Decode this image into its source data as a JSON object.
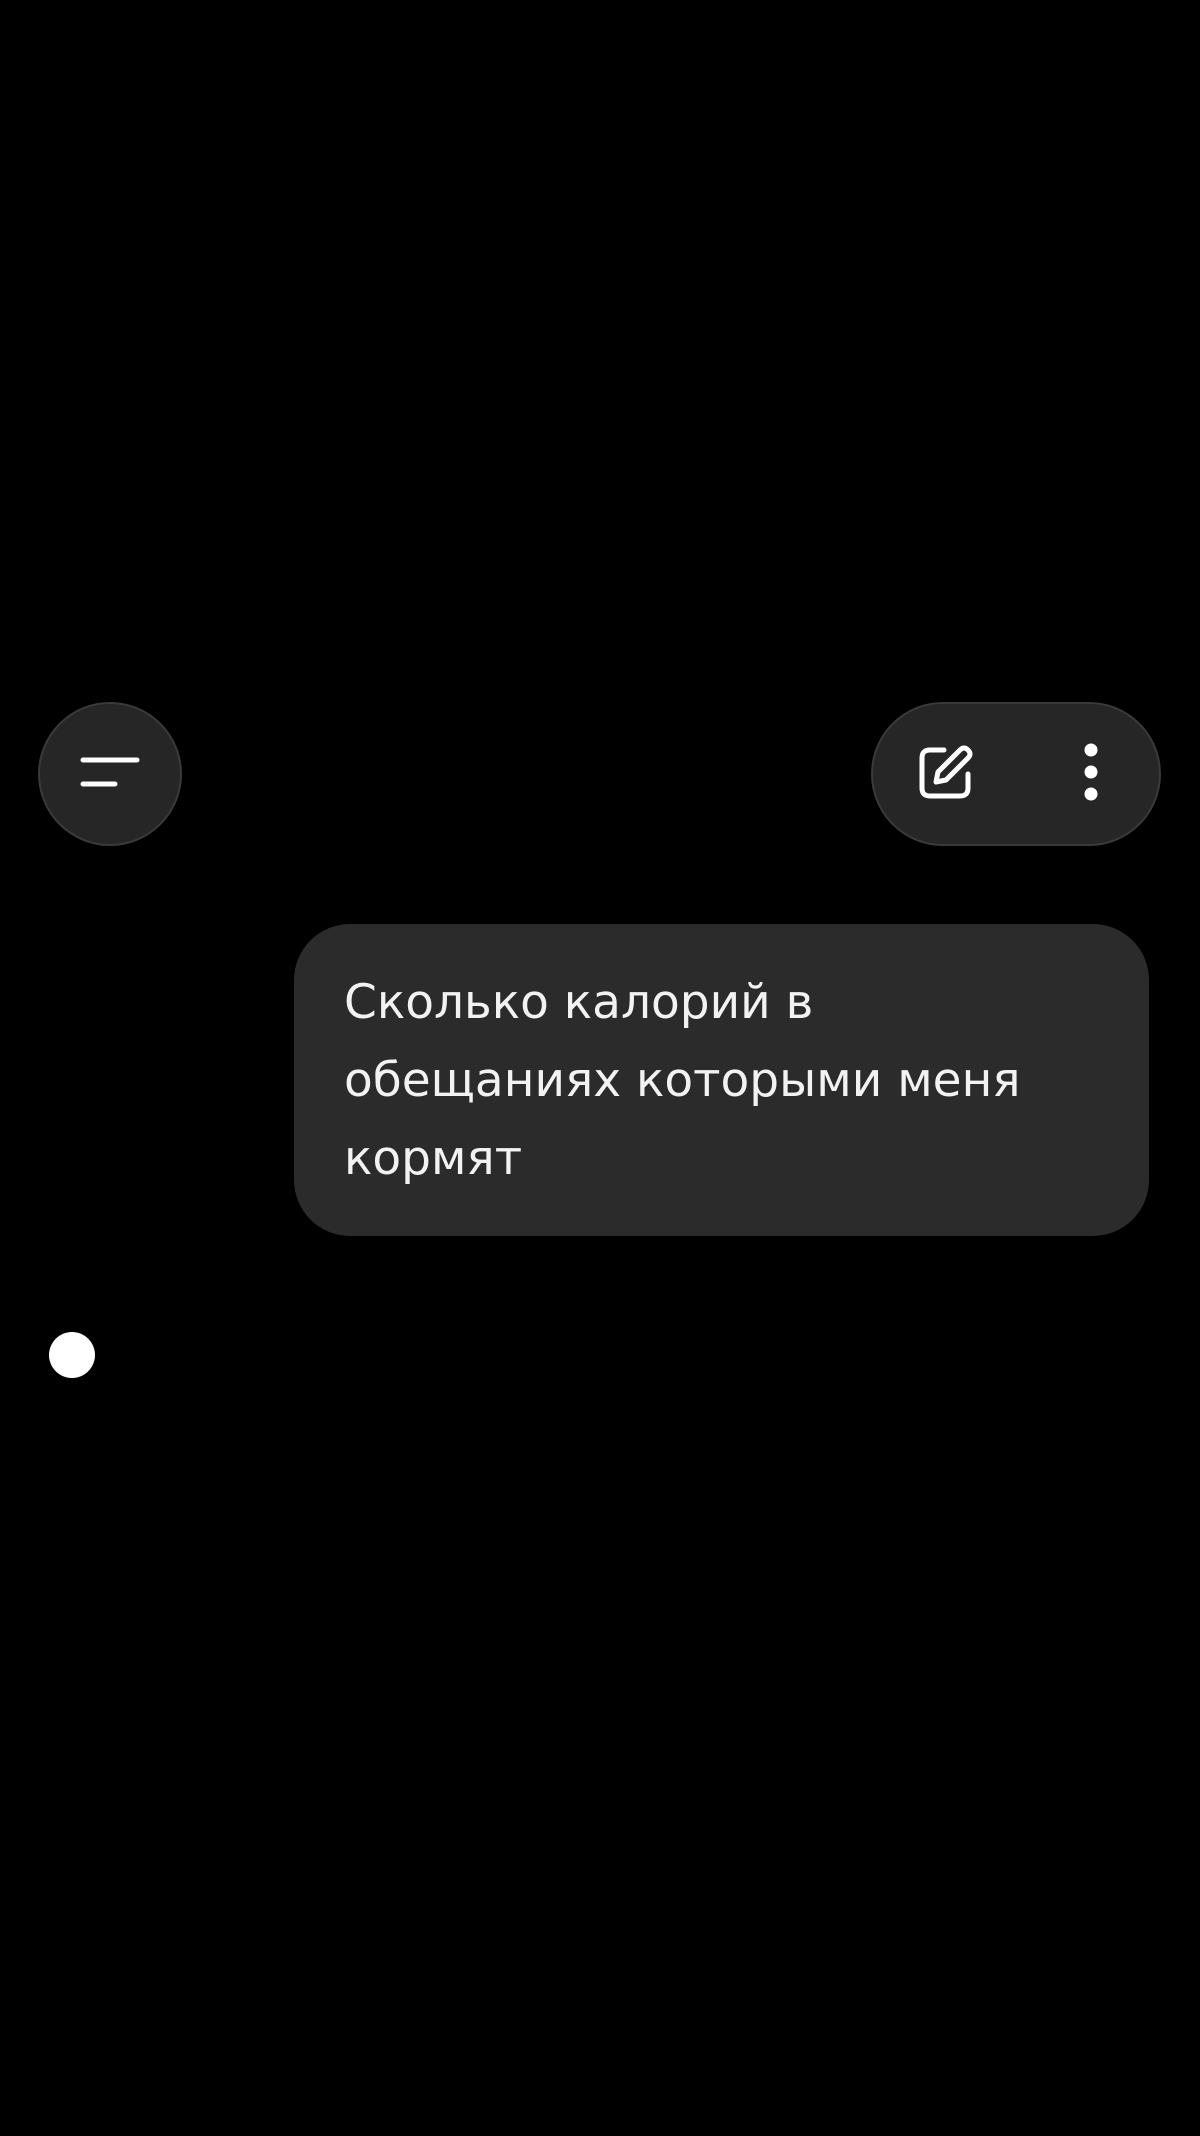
{
  "header": {
    "menu_icon": "menu-lines-icon",
    "edit_icon": "new-chat-edit-icon",
    "more_icon": "more-vertical-icon"
  },
  "chat": {
    "messages": [
      {
        "role": "user",
        "text": "Сколько калорий в обещаниях которыми меня кормят"
      }
    ]
  },
  "colors": {
    "background": "#000000",
    "control_bg": "#262626",
    "bubble_bg": "#2b2b2b",
    "text": "#f2f2f2"
  }
}
